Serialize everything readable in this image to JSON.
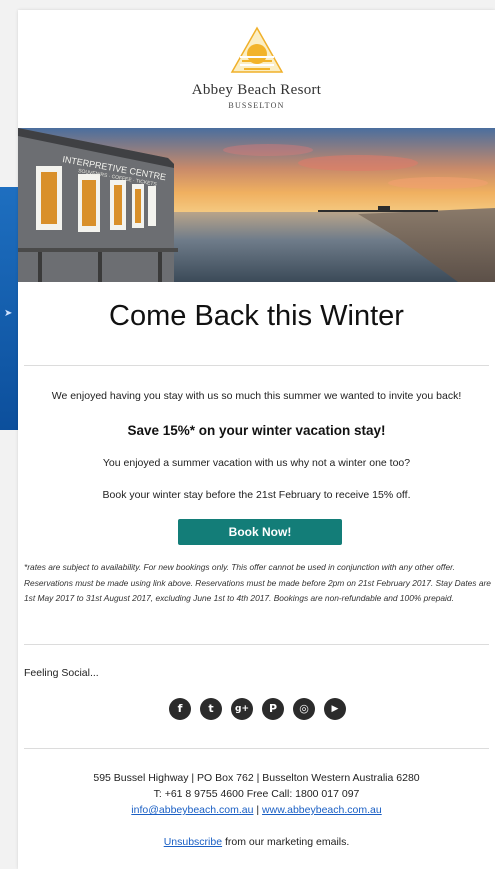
{
  "background": {
    "panel_color": "#1565c0",
    "arrow": "➤"
  },
  "logo": {
    "name": "Abbey Beach Resort",
    "location": "BUSSELTON",
    "color": "#f2b32a"
  },
  "hero": {
    "sign_text": "INTERPRETIVE CENTRE",
    "sign_subtext": "SOUVENIRS · COFFEE · TICKETS"
  },
  "title": "Come Back this Winter",
  "body": {
    "intro": "We enjoyed having you stay with us so much this summer we wanted to invite you back!",
    "offer": "Save 15%* on your winter vacation stay!",
    "line1": "You enjoyed a summer vacation with us why not a winter one too?",
    "line2": "Book your winter stay before the 21st February to receive 15% off."
  },
  "cta": {
    "label": "Book Now!",
    "color": "#137d78"
  },
  "terms": "*rates are subject to availability. For new bookings only. This offer cannot be used in conjunction with any other offer. Reservations must be made using link above. Reservations must be made before 2pm on 21st February 2017. Stay Dates are 1st May 2017 to 31st August 2017, excluding June 1st to 4th 2017. Bookings are non-refundable and 100% prepaid.",
  "social": {
    "label": "Feeling Social...",
    "icons": [
      {
        "name": "facebook-icon",
        "glyph": "f"
      },
      {
        "name": "twitter-icon",
        "glyph": "t"
      },
      {
        "name": "google-plus-icon",
        "glyph": "g+"
      },
      {
        "name": "pinterest-icon",
        "glyph": "P"
      },
      {
        "name": "instagram-icon",
        "glyph": "◎"
      },
      {
        "name": "youtube-icon",
        "glyph": "▶"
      }
    ]
  },
  "footer": {
    "address": "595 Bussel Highway | PO Box 762 | Busselton Western Australia 6280",
    "phone": "T: +61 8 9755 4600 Free Call: 1800 017 097",
    "email": "info@abbeybeach.com.au",
    "separator": "|",
    "website": "www.abbeybeach.com.au",
    "unsubscribe_link": "Unsubscribe",
    "unsubscribe_text": "from our marketing emails."
  }
}
